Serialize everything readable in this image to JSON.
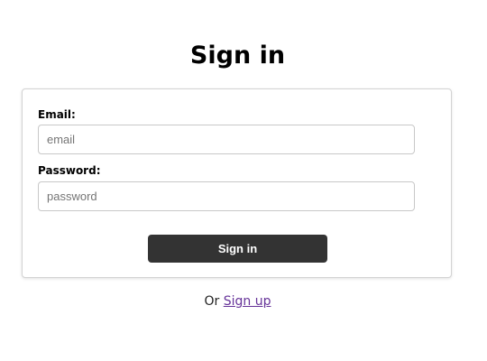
{
  "header": {
    "title": "Sign in"
  },
  "form": {
    "email_label": "Email:",
    "email_value": "",
    "email_placeholder": "email",
    "password_label": "Password:",
    "password_value": "",
    "password_placeholder": "password",
    "submit_label": "Sign in"
  },
  "footer": {
    "prefix": "Or",
    "signup_link": "Sign up"
  },
  "colors": {
    "button_bg": "#333333",
    "link": "#663399",
    "card_border": "#d3d3d3"
  }
}
